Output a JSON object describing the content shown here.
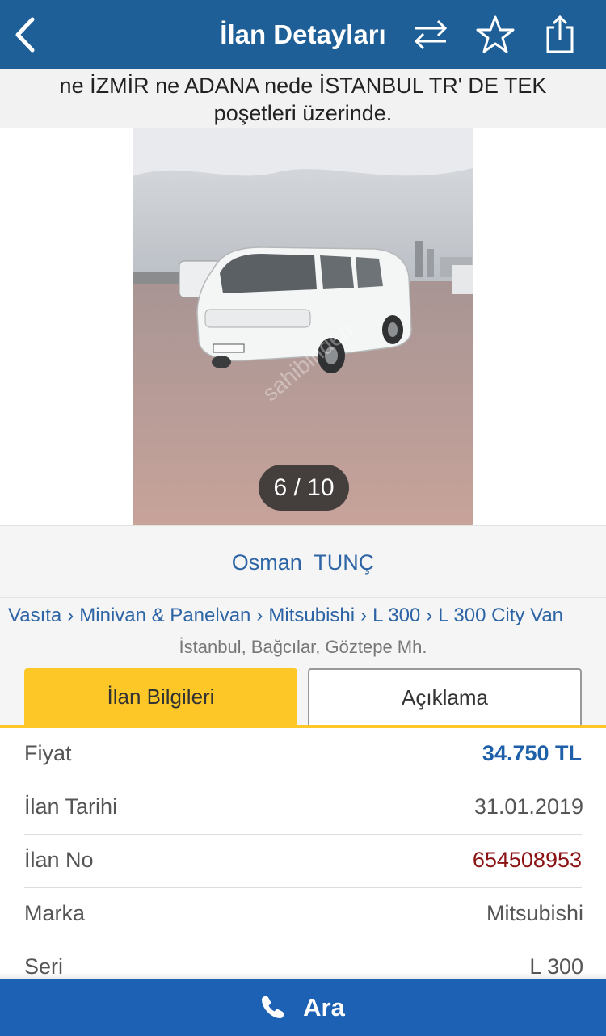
{
  "navbar": {
    "title": "İlan Detayları",
    "icons": [
      "back-chevron-icon",
      "compare-arrows-icon",
      "star-icon",
      "share-icon"
    ]
  },
  "notice": {
    "line1": "ne İZMİR ne ADANA nede İSTANBUL TR' DE TEK",
    "line2": "poşetleri üzerinde."
  },
  "gallery": {
    "counter": "6 / 10",
    "watermark": "sahibinden"
  },
  "seller": {
    "name": "Osman  TUNÇ"
  },
  "breadcrumb": {
    "items": [
      "Vasıta",
      "Minivan & Panelvan",
      "Mitsubishi",
      "L 300",
      "L 300 City Van"
    ],
    "separator": "›"
  },
  "location": "İstanbul, Bağcılar, Göztepe Mh.",
  "tabs": [
    {
      "label": "İlan Bilgileri",
      "active": true
    },
    {
      "label": "Açıklama",
      "active": false
    }
  ],
  "details": [
    {
      "label": "Fiyat",
      "value": "34.750 TL"
    },
    {
      "label": "İlan Tarihi",
      "value": "31.01.2019"
    },
    {
      "label": "İlan No",
      "value": "654508953"
    },
    {
      "label": "Marka",
      "value": "Mitsubishi"
    },
    {
      "label": "Seri",
      "value": "L 300"
    }
  ],
  "callbar": {
    "label": "Ara",
    "icon": "phone-icon"
  },
  "colors": {
    "navbar": "#1d5f96",
    "accent_tab": "#fdc827",
    "link": "#2d64a5",
    "price": "#1d5fa8",
    "ad_number": "#8b1212",
    "call_bar": "#1d61b4"
  }
}
